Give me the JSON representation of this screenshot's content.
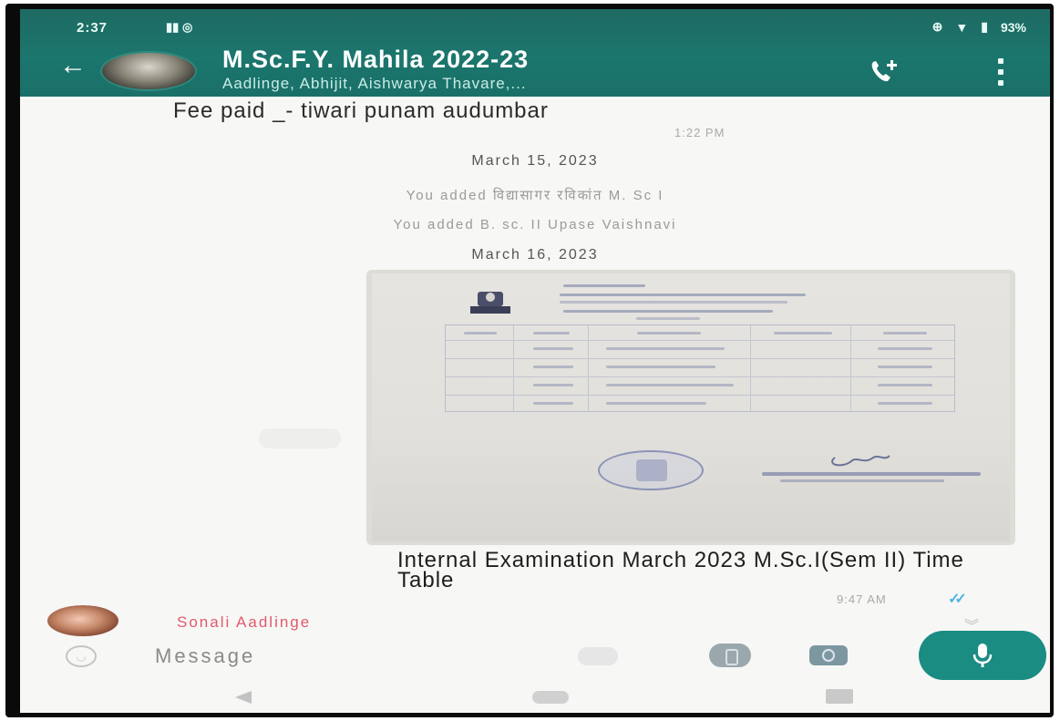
{
  "status_bar": {
    "time": "2:37",
    "battery": "93%",
    "notification_icons": [
      "facebook-icon",
      "whatsapp-icon"
    ],
    "right_icons": [
      "data-saver-icon",
      "wifi-icon",
      "battery-icon"
    ]
  },
  "header": {
    "title": "M.Sc.F.Y. Mahila 2022-23",
    "subtitle": "Aadlinge, Abhijit, Aishwarya Thavare,...",
    "icons": [
      "back-arrow-icon",
      "group-avatar",
      "add-call-icon",
      "more-vert-icon"
    ],
    "accent_color": "#1b766d"
  },
  "messages": [
    {
      "type": "text",
      "text": "Fee paid _- tiwari punam audumbar",
      "time": "1:22 PM"
    },
    {
      "type": "date",
      "text": "March 15, 2023"
    },
    {
      "type": "system",
      "text": "You added विद्यासागर रविकांत M. Sc I"
    },
    {
      "type": "system",
      "text": "You added B. sc. II Upase Vaishnavi"
    },
    {
      "type": "date",
      "text": "March 16, 2023"
    },
    {
      "type": "image",
      "caption": "Internal Examination March 2023 M.Sc.I(Sem II) Time Table",
      "time": "9:47 AM",
      "read_receipt_color": "#4fb6e8"
    }
  ],
  "typing_sender": {
    "name": "Sonali Aadlinge",
    "name_color": "#e05a6b"
  },
  "composer": {
    "placeholder": "Message",
    "icons": [
      "emoji-icon",
      "attach-icon",
      "rupee-payment-icon",
      "camera-icon",
      "mic-icon"
    ],
    "mic_button_color": "#1a8c82"
  },
  "navigation": {
    "icons": [
      "nav-back-icon",
      "nav-home-icon",
      "nav-recents-icon"
    ]
  }
}
